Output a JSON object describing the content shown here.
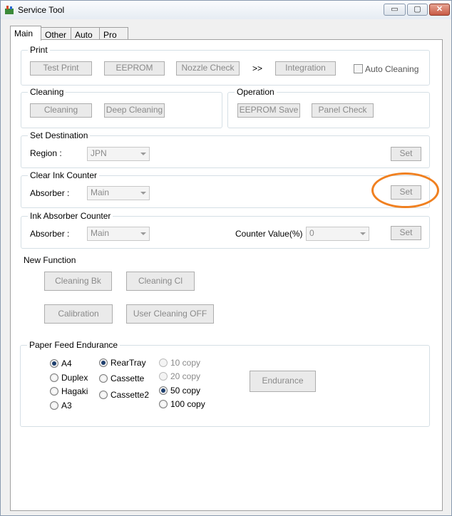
{
  "window": {
    "title": "Service Tool",
    "minimize": "▭",
    "maximize": "▢",
    "close": "✕"
  },
  "tabs": [
    "Main",
    "Other",
    "Auto",
    "Pro"
  ],
  "print": {
    "label": "Print",
    "test_print": "Test Print",
    "eeprom": "EEPROM",
    "nozzle_check": "Nozzle Check",
    "arrow": ">>",
    "integration": "Integration",
    "auto_cleaning": "Auto Cleaning"
  },
  "cleaning": {
    "label": "Cleaning",
    "cleaning": "Cleaning",
    "deep_cleaning": "Deep Cleaning"
  },
  "operation": {
    "label": "Operation",
    "eeprom_save": "EEPROM Save",
    "panel_check": "Panel Check"
  },
  "set_destination": {
    "label": "Set Destination",
    "region_label": "Region :",
    "region_value": "JPN",
    "set": "Set"
  },
  "clear_ink_counter": {
    "label": "Clear Ink Counter",
    "absorber_label": "Absorber :",
    "absorber_value": "Main",
    "set": "Set"
  },
  "ink_absorber_counter": {
    "label": "Ink Absorber Counter",
    "absorber_label": "Absorber :",
    "absorber_value": "Main",
    "counter_label": "Counter Value(%) :",
    "counter_value": "0",
    "set": "Set"
  },
  "new_function": {
    "label": "New Function",
    "cleaning_bk": "Cleaning Bk",
    "cleaning_cl": "Cleaning Cl",
    "calibration": "Calibration",
    "user_cleaning_off": "User Cleaning OFF"
  },
  "paper_feed": {
    "label": "Paper Feed Endurance",
    "paper": [
      "A4",
      "Duplex",
      "Hagaki",
      "A3"
    ],
    "tray": [
      "RearTray",
      "Cassette",
      "Cassette2"
    ],
    "copies": [
      "10 copy",
      "20 copy",
      "50 copy",
      "100 copy"
    ],
    "endurance": "Endurance"
  },
  "colors": {
    "highlight": "#f08020"
  }
}
